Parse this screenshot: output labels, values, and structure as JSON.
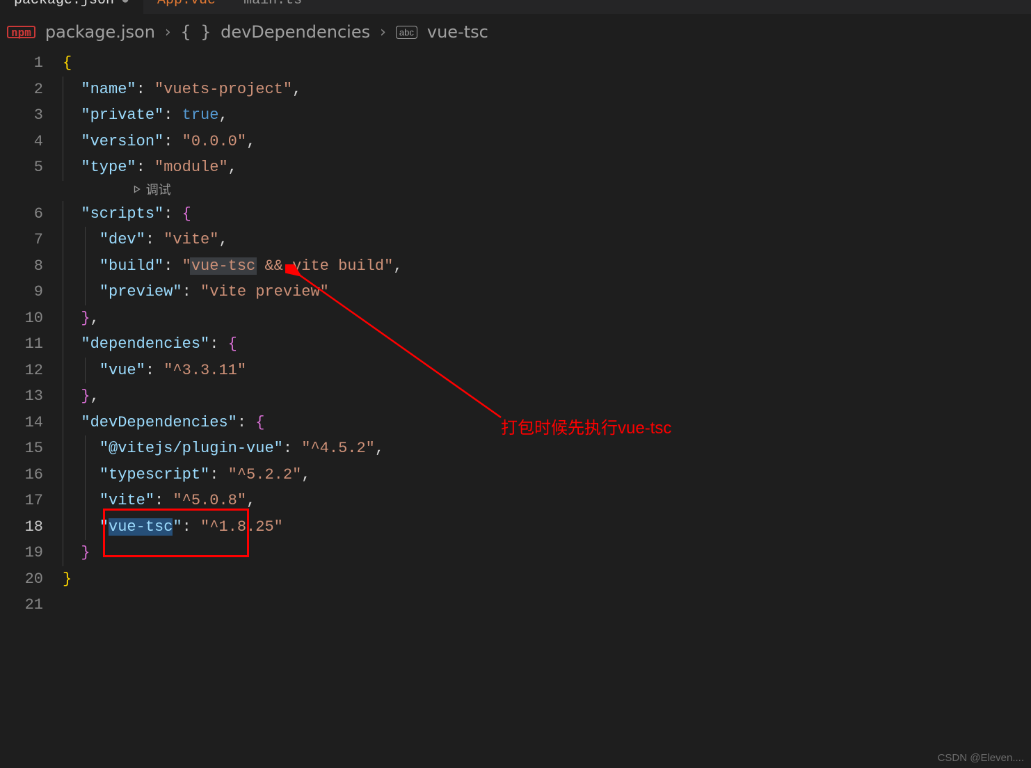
{
  "tabs": [
    {
      "name": "package.json",
      "active": true
    },
    {
      "name": "App.vue",
      "active": false
    },
    {
      "name": "main.ts",
      "active": false
    }
  ],
  "breadcrumb": {
    "file": "package.json",
    "path1": "devDependencies",
    "path2": "vue-tsc"
  },
  "codelens": {
    "label": "调试"
  },
  "json": {
    "name_key": "\"name\"",
    "name_val": "\"vuets-project\"",
    "private_key": "\"private\"",
    "private_val": "true",
    "version_key": "\"version\"",
    "version_val": "\"0.0.0\"",
    "type_key": "\"type\"",
    "type_val": "\"module\"",
    "scripts_key": "\"scripts\"",
    "dev_key": "\"dev\"",
    "dev_val": "\"vite\"",
    "build_key": "\"build\"",
    "build_val_q": "\"",
    "build_val_hl": "vue-tsc",
    "build_val_rest": " && vite build\"",
    "preview_key": "\"preview\"",
    "preview_val": "\"vite preview\"",
    "deps_key": "\"dependencies\"",
    "vue_key": "\"vue\"",
    "vue_val": "\"^3.3.11\"",
    "devdeps_key": "\"devDependencies\"",
    "plugin_key": "\"@vitejs/plugin-vue\"",
    "plugin_val": "\"^4.5.2\"",
    "ts_key": "\"typescript\"",
    "ts_val": "\"^5.2.2\"",
    "vite_key": "\"vite\"",
    "vite_val": "\"^5.0.8\"",
    "vuetsc_key_q": "\"",
    "vuetsc_key_sel": "vue-tsc",
    "vuetsc_key_end": "\"",
    "vuetsc_val": "\"^1.8.25\""
  },
  "lines": [
    "1",
    "2",
    "3",
    "4",
    "5",
    "6",
    "7",
    "8",
    "9",
    "10",
    "11",
    "12",
    "13",
    "14",
    "15",
    "16",
    "17",
    "18",
    "19",
    "20",
    "21"
  ],
  "annotation": "打包时候先执行vue-tsc",
  "watermark": "CSDN @Eleven...."
}
